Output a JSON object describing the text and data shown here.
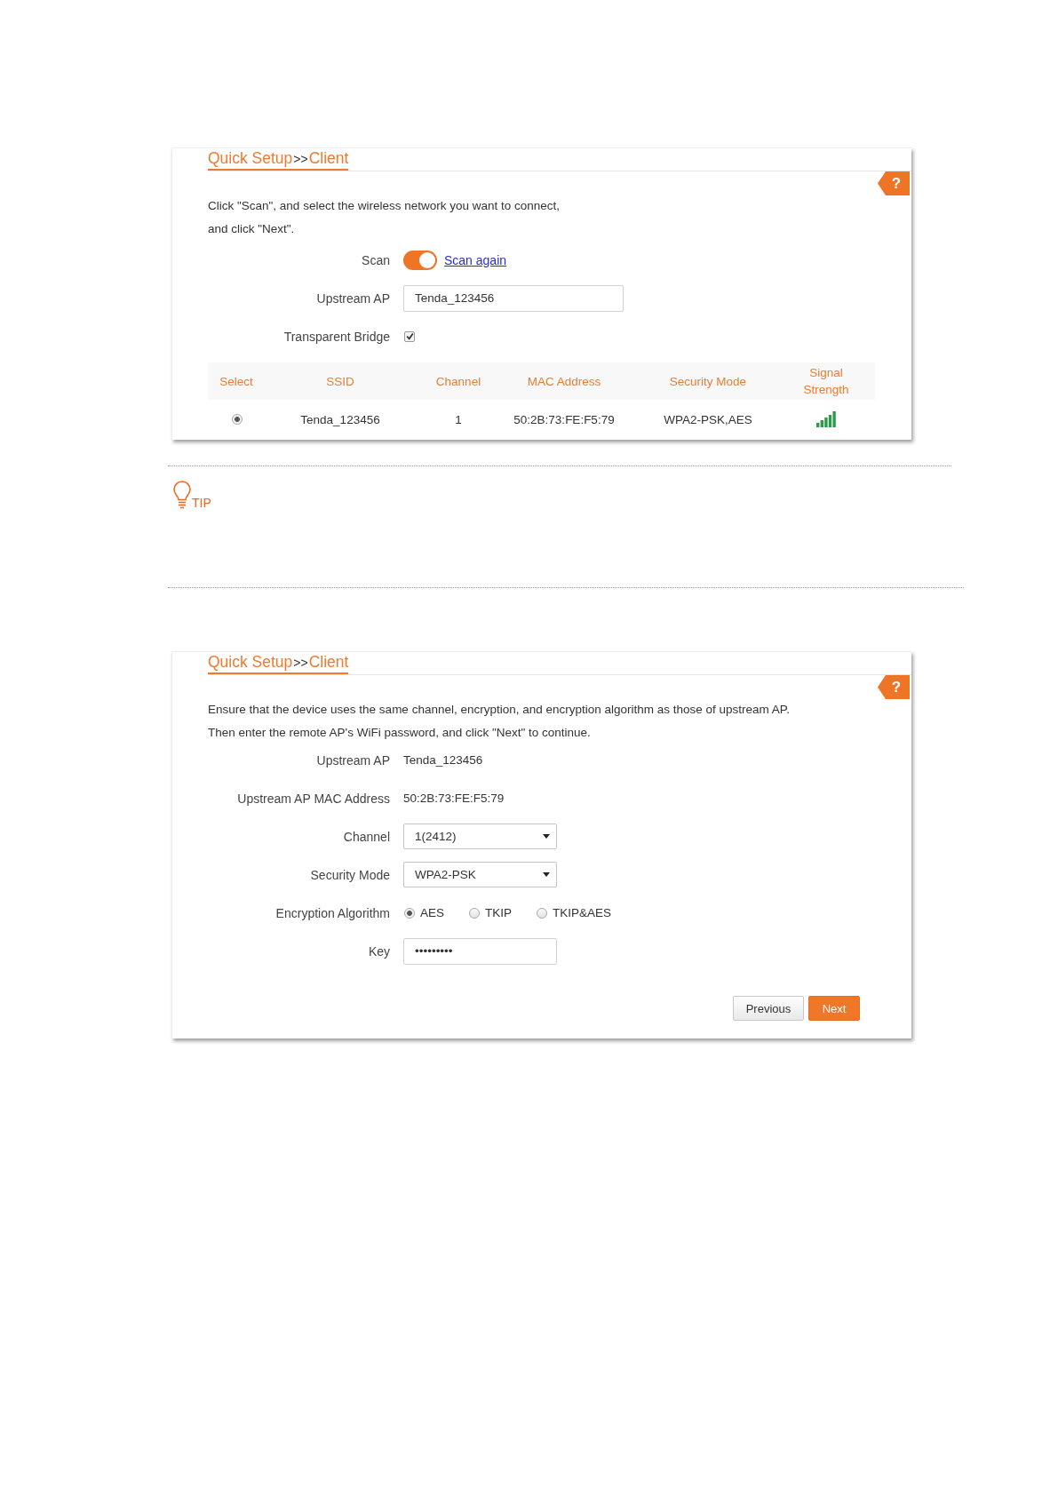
{
  "sections": [
    {
      "kind": "panel",
      "breadcrumb": [
        "Quick Setup",
        "Client"
      ],
      "separator": ">>",
      "help": "?",
      "instructions": [
        "Click \"Scan\", and select the wireless network you want to connect,",
        "and click \"Next\"."
      ],
      "fields": [
        {
          "kind": "toggle",
          "label": "Scan",
          "on": true,
          "link": "Scan again"
        },
        {
          "kind": "text_input",
          "label": "Upstream AP",
          "value": "Tenda_123456"
        },
        {
          "kind": "checkbox",
          "label": "Transparent Bridge",
          "checked": true
        }
      ],
      "table": {
        "columns": [
          "Select",
          "SSID",
          "Channel",
          "MAC Address",
          "Security Mode",
          "Signal Strength"
        ],
        "rows": [
          {
            "cells": [
              {
                "kind": "radio",
                "selected": true
              },
              {
                "kind": "text",
                "text": "Tenda_123456"
              },
              {
                "kind": "text",
                "text": "1"
              },
              {
                "kind": "text",
                "text": "50:2B:73:FE:F5:79"
              },
              {
                "kind": "text",
                "text": "WPA2-PSK,AES"
              },
              {
                "kind": "signal"
              }
            ]
          }
        ]
      }
    },
    {
      "kind": "tip",
      "label": "TIP"
    },
    {
      "kind": "panel",
      "breadcrumb": [
        "Quick Setup",
        "Client"
      ],
      "separator": ">>",
      "help": "?",
      "instructions": [
        "Ensure that the device uses the same channel, encryption, and encryption algorithm as those of upstream AP.",
        "Then enter the remote AP's WiFi password, and click \"Next\" to continue."
      ],
      "fields": [
        {
          "kind": "static",
          "label": "Upstream AP",
          "value": "Tenda_123456"
        },
        {
          "kind": "static",
          "label": "Upstream AP MAC Address",
          "value": "50:2B:73:FE:F5:79"
        },
        {
          "kind": "select",
          "label": "Channel",
          "value": "1(2412)"
        },
        {
          "kind": "select",
          "label": "Security Mode",
          "value": "WPA2-PSK"
        },
        {
          "kind": "radio_group",
          "label": "Encryption Algorithm",
          "options": [
            {
              "label": "AES",
              "selected": true
            },
            {
              "label": "TKIP",
              "selected": false
            },
            {
              "label": "TKIP&AES",
              "selected": false
            }
          ]
        },
        {
          "kind": "password",
          "label": "Key",
          "value": "•••••••••"
        }
      ],
      "buttons": [
        {
          "label": "Previous",
          "kind": "secondary"
        },
        {
          "label": "Next",
          "kind": "primary"
        }
      ]
    }
  ]
}
